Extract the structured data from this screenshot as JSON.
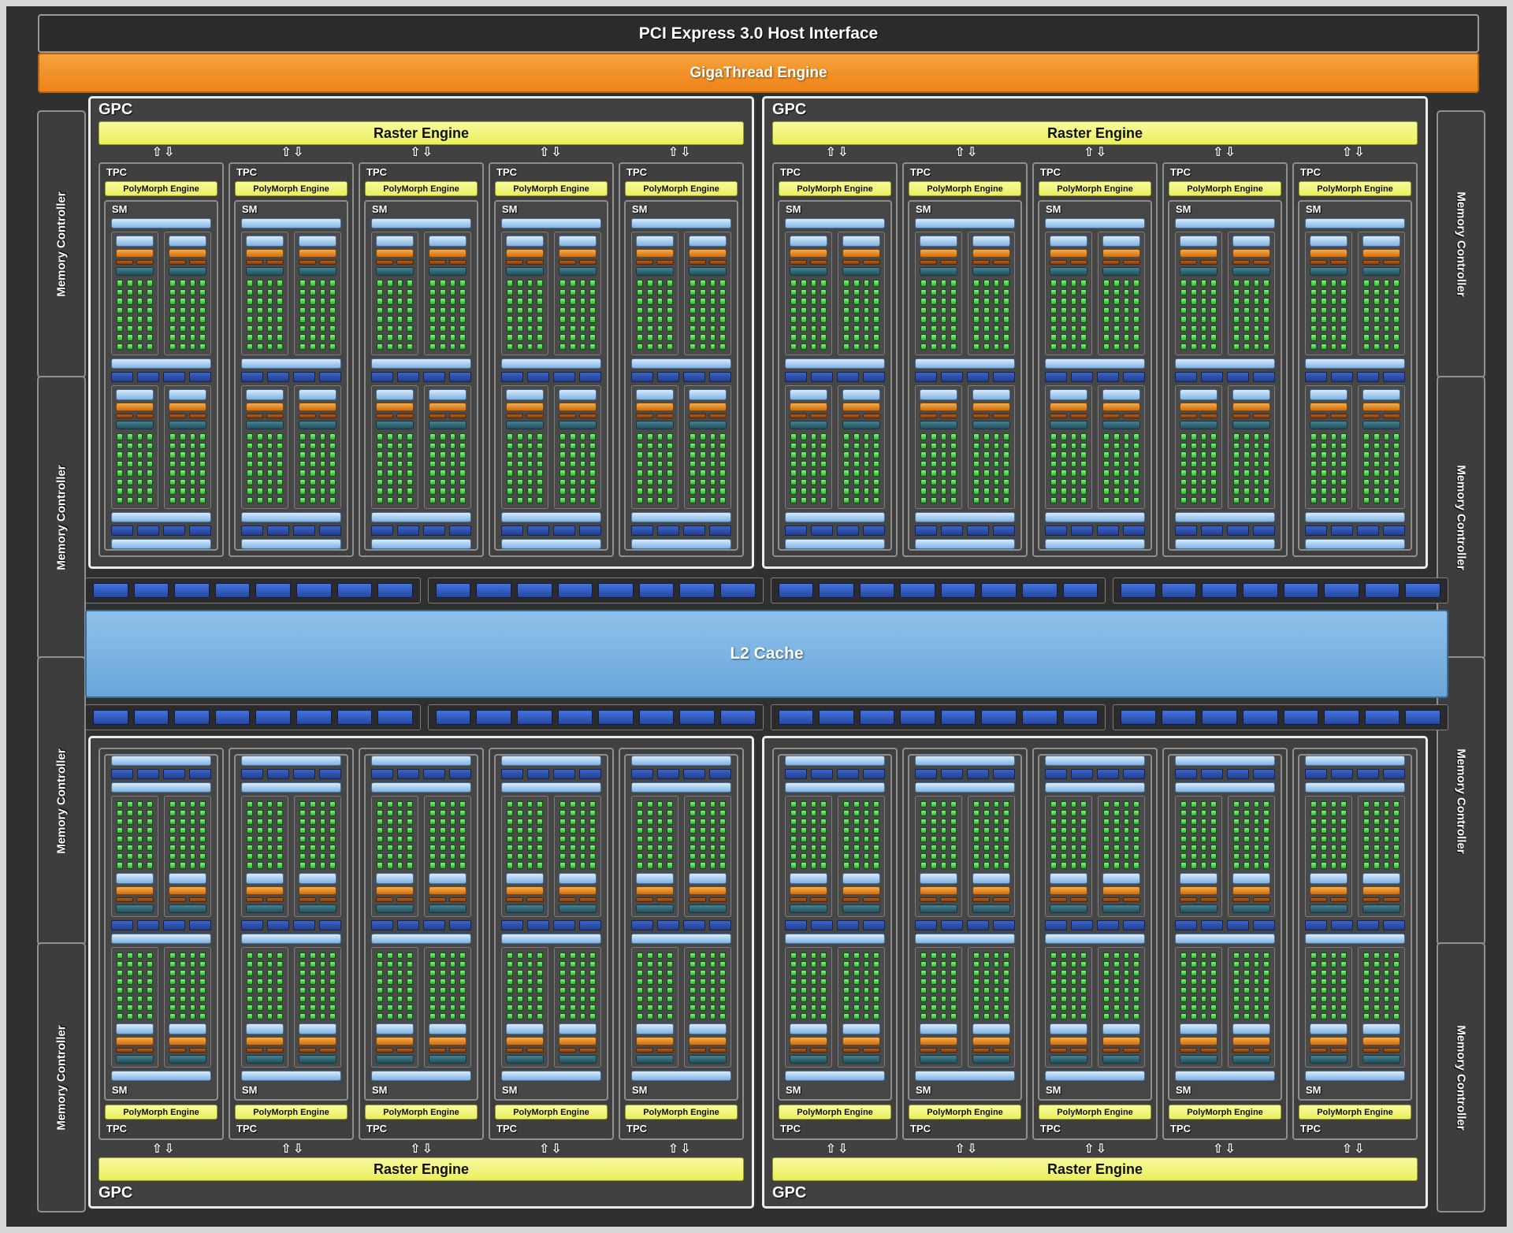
{
  "header": {
    "pci_label": "PCI Express 3.0 Host Interface",
    "gigathread_label": "GigaThread Engine"
  },
  "labels": {
    "gpc": "GPC",
    "tpc": "TPC",
    "sm": "SM",
    "raster_engine": "Raster Engine",
    "polymorph_engine": "PolyMorph Engine",
    "l2_cache": "L2 Cache",
    "memory_controller": "Memory Controller",
    "arrow_up": "⇧",
    "arrow_down": "⇩"
  },
  "structure": {
    "gpc_count": 4,
    "gpc_layout": "2 top, 2 bottom (bottom pair vertically mirrored)",
    "tpcs_per_gpc": 5,
    "sms_per_tpc": 1,
    "processing_blocks_per_sm": 2,
    "partitions_per_block": 2,
    "core_rows_per_partition": 8,
    "core_cols_per_partition": 4,
    "cores_per_partition": 32,
    "cores_per_sm": 128,
    "dispatch_bars_per_partition": 2,
    "ldst_cells_per_navy_row": 4,
    "navy_rows_per_sm": 2,
    "memory_controllers_per_side": 4,
    "crossbar_rows": 2,
    "crossbar_groups_per_row": 4,
    "crossbar_cells_per_group": 8
  },
  "colors": {
    "frame": "#d8d8d8",
    "background": "#303030",
    "pci_bar": "#2b2b2b",
    "gigathread_orange": "#f0922e",
    "engine_yellow": "#f2f573",
    "light_blue_bar": "#9cc4ea",
    "l2_blue": "#79b1e0",
    "warp_scheduler_orange": "#ec9334",
    "dispatch_brown": "#a85415",
    "register_file_teal": "#376b76",
    "cuda_core_green": "#3ecc3e",
    "ldst_navy": "#2b4fa5",
    "crossbar_blue": "#2f5fc8"
  }
}
